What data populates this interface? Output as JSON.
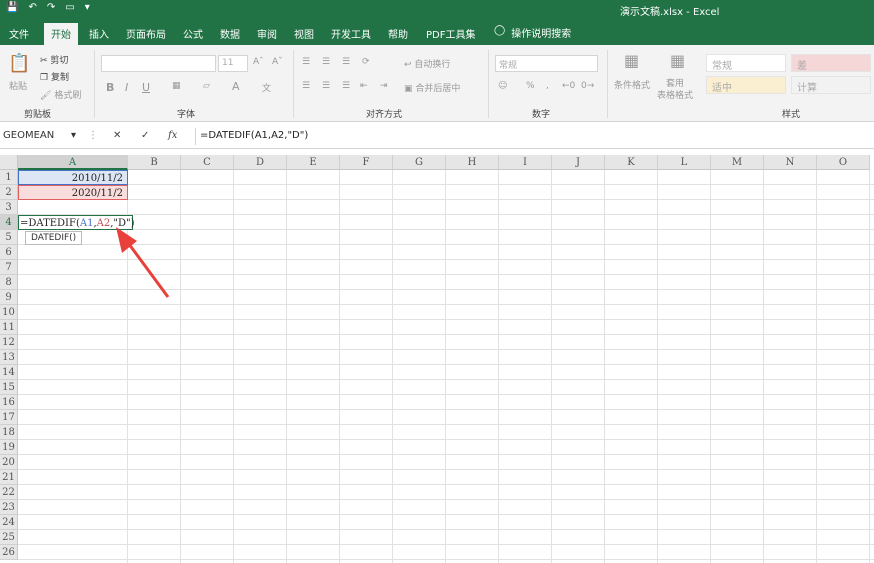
{
  "app": {
    "title": "演示文稿.xlsx  -  Excel"
  },
  "quick_access": [
    "save-icon",
    "undo-icon",
    "redo-icon",
    "print-preview-icon"
  ],
  "tabs": [
    {
      "label": "文件"
    },
    {
      "label": "开始",
      "active": true
    },
    {
      "label": "插入"
    },
    {
      "label": "页面布局"
    },
    {
      "label": "公式"
    },
    {
      "label": "数据"
    },
    {
      "label": "审阅"
    },
    {
      "label": "视图"
    },
    {
      "label": "开发工具"
    },
    {
      "label": "帮助"
    },
    {
      "label": "PDF工具集"
    }
  ],
  "tell_me": "操作说明搜索",
  "ribbon": {
    "clipboard": {
      "label": "剪贴板",
      "paste": "粘贴",
      "cut": "剪切",
      "copy": "复制",
      "format_painter": "格式刷"
    },
    "font": {
      "label": "字体",
      "size": "11",
      "bold": "B",
      "italic": "I",
      "underline": "U"
    },
    "alignment": {
      "label": "对齐方式",
      "wrap": "自动换行",
      "merge": "合并后居中"
    },
    "number": {
      "label": "数字",
      "format": "常规",
      "percent": "%"
    },
    "styles": {
      "label": "样式",
      "conditional": "条件格式",
      "table_format": "套用\n表格格式",
      "cells": [
        "常规",
        "差",
        "适中",
        "计算"
      ]
    }
  },
  "formula_bar": {
    "name_box": "GEOMEAN",
    "cancel": "✕",
    "enter": "✓",
    "fx": "fx",
    "content": "=DATEDIF(A1,A2,\"D\")"
  },
  "columns": [
    "A",
    "B",
    "C",
    "D",
    "E",
    "F",
    "G",
    "H",
    "I",
    "J",
    "K",
    "L",
    "M",
    "N",
    "O"
  ],
  "rows": [
    "1",
    "2",
    "3",
    "4",
    "5",
    "6",
    "7",
    "8",
    "9",
    "10",
    "11",
    "12",
    "13",
    "14",
    "15",
    "16",
    "17",
    "18",
    "19",
    "20",
    "21",
    "22",
    "23",
    "24",
    "25",
    "26"
  ],
  "cells": {
    "A1": "2010/11/2",
    "A2": "2020/11/2",
    "A4_parts": [
      "=DATEDIF(",
      "A1",
      ",",
      "A2",
      ",\"D\")"
    ]
  },
  "tooltip": "DATEDIF()",
  "colors": {
    "brand": "#217346",
    "ref1": "#4472c4",
    "ref2": "#c0504d",
    "arrow": "#e8403a"
  }
}
